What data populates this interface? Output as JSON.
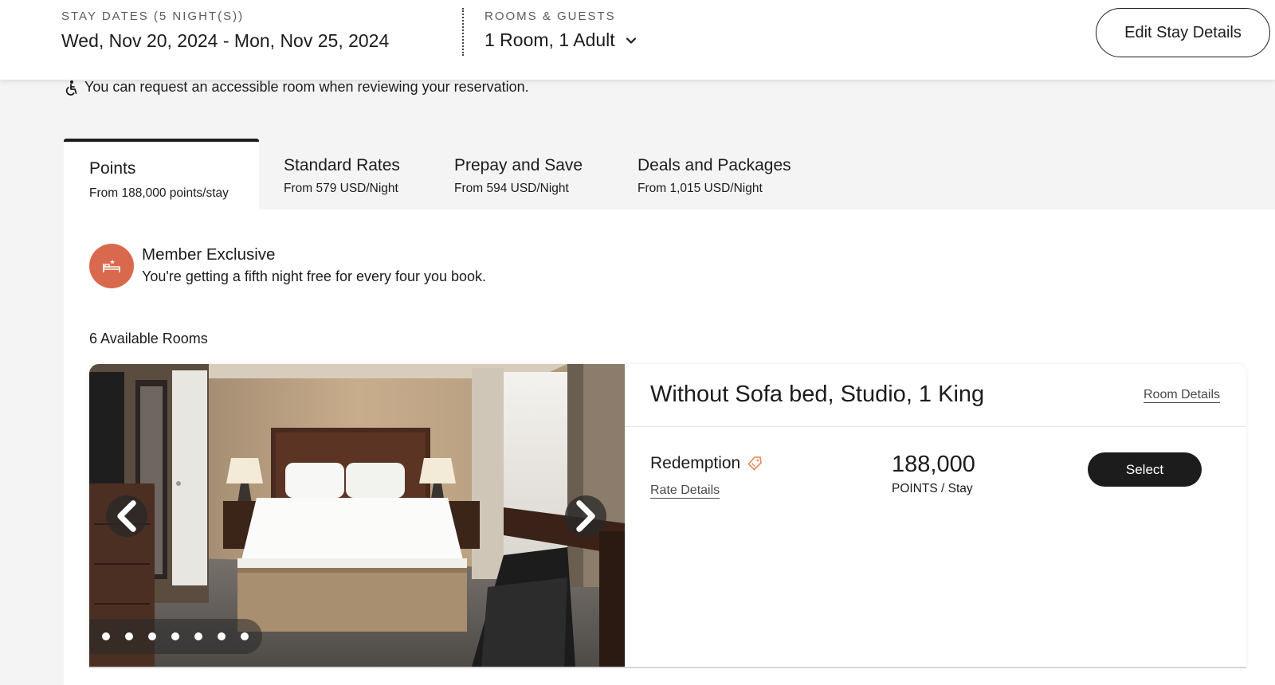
{
  "header": {
    "stay_label": "STAY DATES (5 NIGHT(S))",
    "stay_dates": "Wed, Nov 20, 2024 - Mon, Nov 25, 2024",
    "guests_label": "ROOMS & GUESTS",
    "guests_value": "1 Room, 1 Adult",
    "edit_button": "Edit Stay Details"
  },
  "accessibility_note": "You can request an accessible room when reviewing your reservation.",
  "tabs": [
    {
      "title": "Points",
      "subtitle": "From 188,000 points/stay",
      "active": true
    },
    {
      "title": "Standard Rates",
      "subtitle": "From 579 USD/Night",
      "active": false
    },
    {
      "title": "Prepay and Save",
      "subtitle": "From 594 USD/Night",
      "active": false
    },
    {
      "title": "Deals and Packages",
      "subtitle": "From 1,015 USD/Night",
      "active": false
    }
  ],
  "member": {
    "title": "Member Exclusive",
    "text": "You're getting a fifth night free for every four you book.",
    "accent_color": "#d9694c"
  },
  "available_rooms": "6 Available Rooms",
  "room": {
    "title": "Without Sofa bed, Studio, 1 King",
    "details_link": "Room Details",
    "rate_name": "Redemption",
    "rate_details_link": "Rate Details",
    "points_value": "188,000",
    "points_unit": "POINTS / Stay",
    "select_button": "Select",
    "photo_count": 7
  },
  "colors": {
    "primary": "#1c1c1c",
    "tag": "#e58a5e"
  }
}
